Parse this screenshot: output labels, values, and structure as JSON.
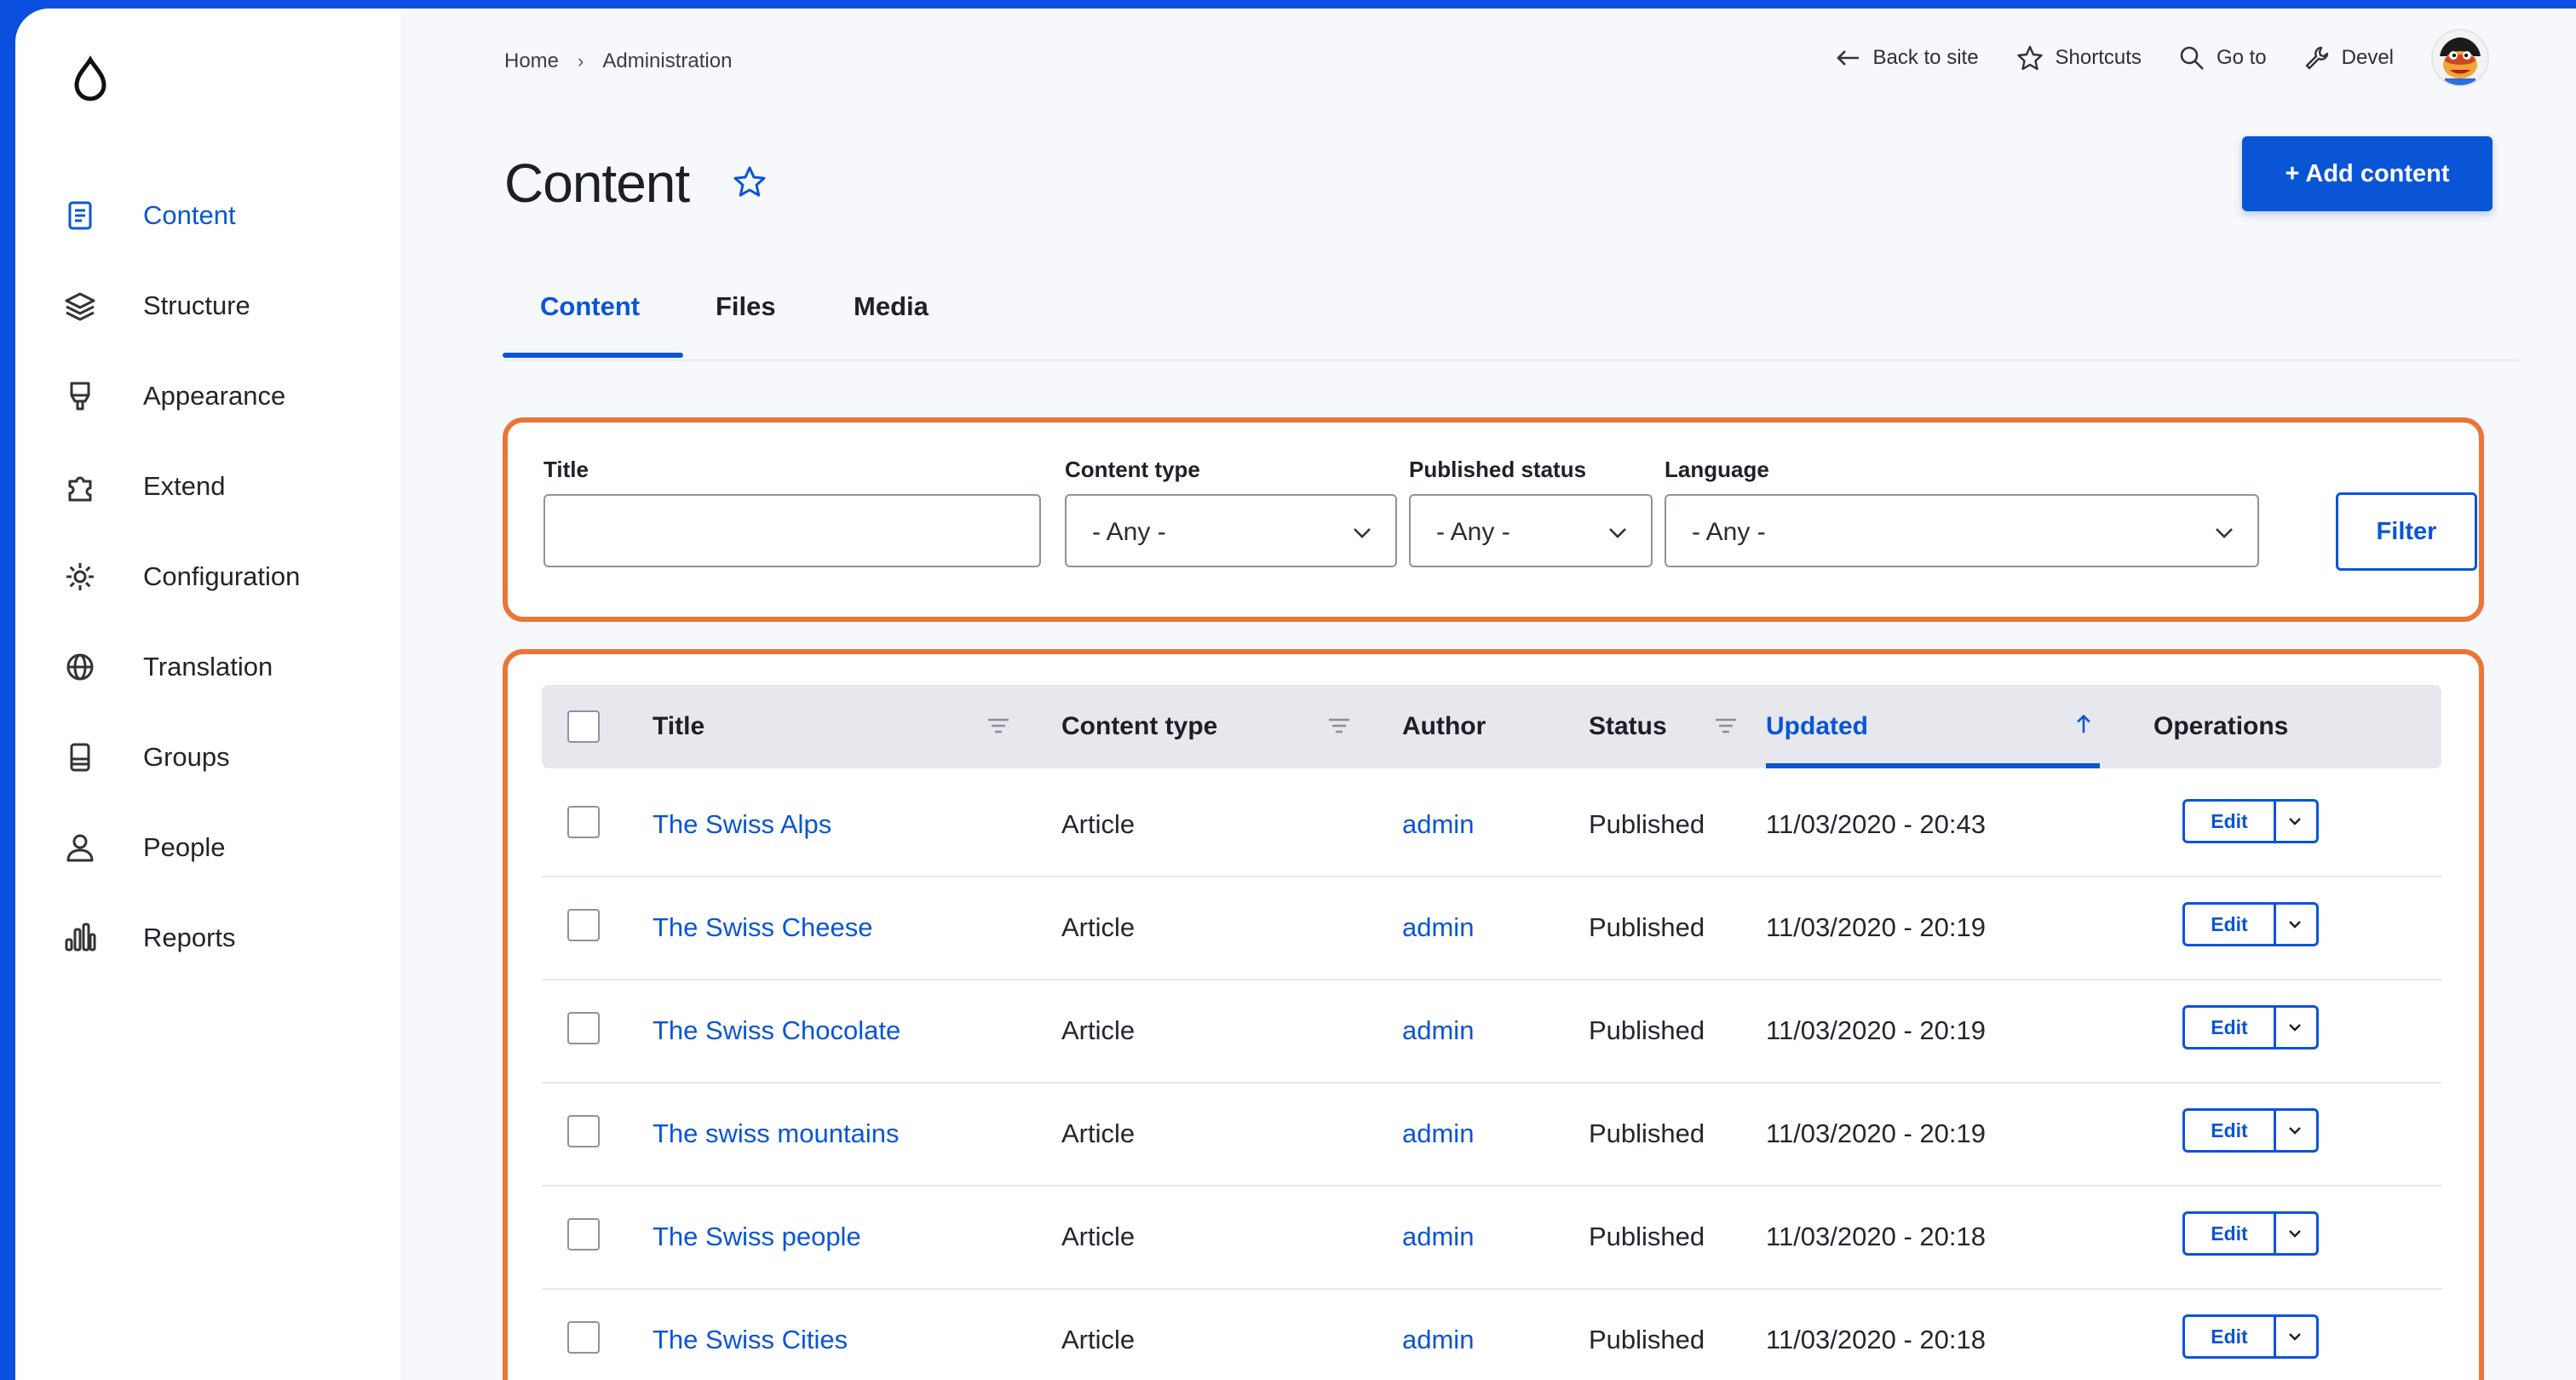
{
  "sidebar": {
    "items": [
      {
        "label": "Content",
        "icon": "file-text-icon"
      },
      {
        "label": "Structure",
        "icon": "layers-icon"
      },
      {
        "label": "Appearance",
        "icon": "paint-brush-icon"
      },
      {
        "label": "Extend",
        "icon": "puzzle-icon"
      },
      {
        "label": "Configuration",
        "icon": "gear-icon"
      },
      {
        "label": "Translation",
        "icon": "globe-icon"
      },
      {
        "label": "Groups",
        "icon": "database-icon"
      },
      {
        "label": "People",
        "icon": "person-icon"
      },
      {
        "label": "Reports",
        "icon": "bar-chart-icon"
      }
    ]
  },
  "breadcrumb": {
    "home": "Home",
    "separator": "›",
    "current": "Administration"
  },
  "toolbar": {
    "back": "Back to site",
    "shortcuts": "Shortcuts",
    "goto": "Go to",
    "devel": "Devel"
  },
  "page": {
    "title": "Content",
    "add_button": "+ Add content"
  },
  "tabs": [
    "Content",
    "Files",
    "Media"
  ],
  "filters": {
    "title_label": "Title",
    "title_value": "",
    "content_type_label": "Content type",
    "content_type_value": "- Any -",
    "published_label": "Published status",
    "published_value": "- Any -",
    "language_label": "Language",
    "language_value": "- Any -",
    "filter_button": "Filter"
  },
  "table": {
    "headers": {
      "title": "Title",
      "content_type": "Content type",
      "author": "Author",
      "status": "Status",
      "updated": "Updated",
      "operations": "Operations"
    },
    "edit_label": "Edit",
    "rows": [
      {
        "title": "The Swiss Alps",
        "type": "Article",
        "author": "admin",
        "status": "Published",
        "updated": "11/03/2020 - 20:43"
      },
      {
        "title": "The Swiss Cheese",
        "type": "Article",
        "author": "admin",
        "status": "Published",
        "updated": "11/03/2020 - 20:19"
      },
      {
        "title": "The Swiss Chocolate",
        "type": "Article",
        "author": "admin",
        "status": "Published",
        "updated": "11/03/2020 - 20:19"
      },
      {
        "title": "The swiss mountains",
        "type": "Article",
        "author": "admin",
        "status": "Published",
        "updated": "11/03/2020 - 20:19"
      },
      {
        "title": "The Swiss people",
        "type": "Article",
        "author": "admin",
        "status": "Published",
        "updated": "11/03/2020 - 20:18"
      },
      {
        "title": "The Swiss Cities",
        "type": "Article",
        "author": "admin",
        "status": "Published",
        "updated": "11/03/2020 - 20:18"
      }
    ]
  },
  "colors": {
    "accent": "#0a55d6",
    "highlight_border": "#ea7537",
    "frame": "#0a4fe0"
  }
}
